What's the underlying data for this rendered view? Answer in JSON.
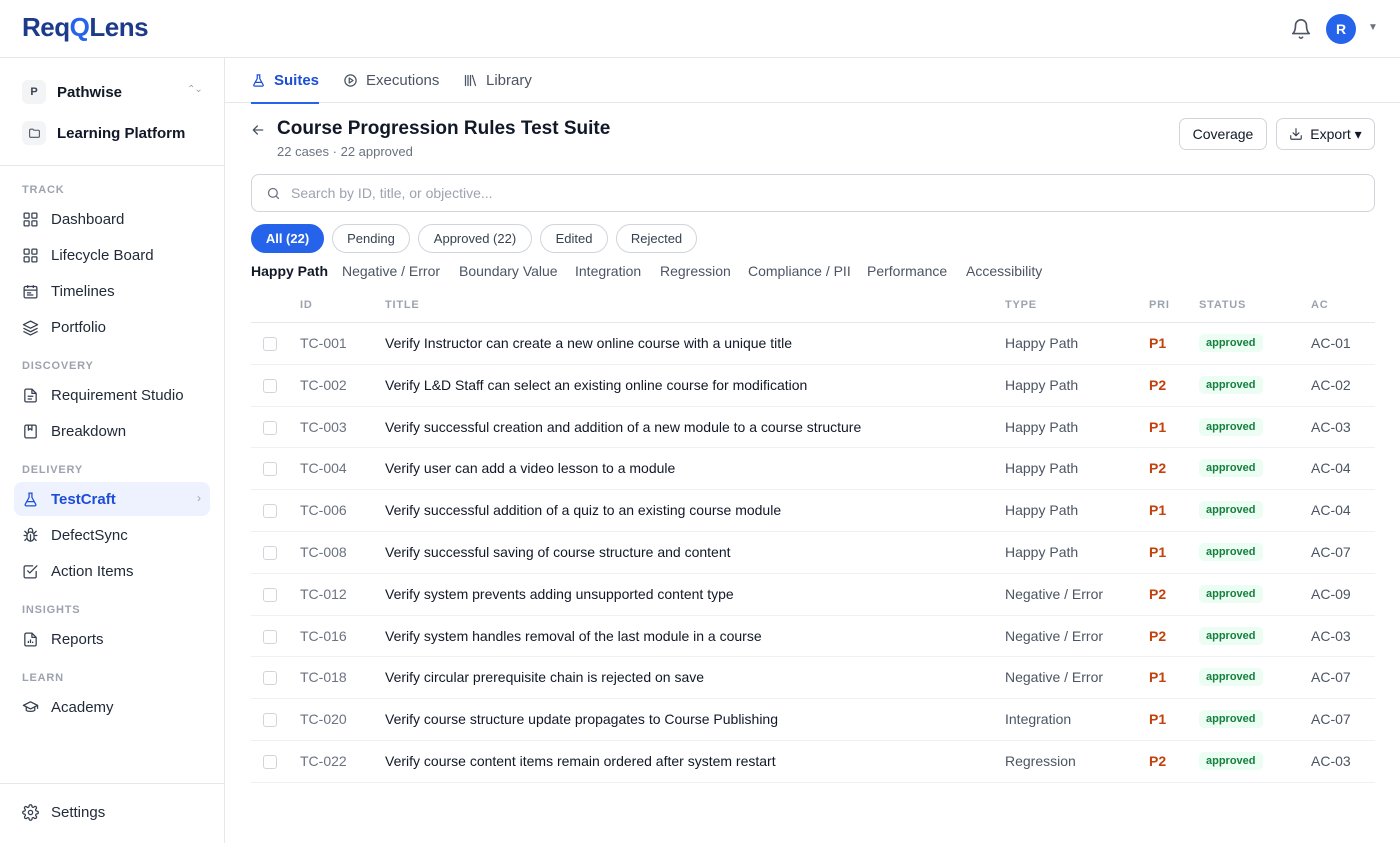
{
  "app": {
    "logo_part1": "Req",
    "logo_q": "Q",
    "logo_part2": "Lens",
    "user_initial": "R"
  },
  "workspace": {
    "org_initial": "P",
    "org_name": "Pathwise",
    "project_name": "Learning Platform"
  },
  "sidebar": {
    "sections": {
      "track": "TRACK",
      "discovery": "DISCOVERY",
      "delivery": "DELIVERY",
      "insights": "INSIGHTS",
      "learn": "LEARN"
    },
    "items": {
      "dashboard": "Dashboard",
      "lifecycle": "Lifecycle Board",
      "timelines": "Timelines",
      "portfolio": "Portfolio",
      "requirement_studio": "Requirement Studio",
      "breakdown": "Breakdown",
      "testcraft": "TestCraft",
      "defectsync": "DefectSync",
      "action_items": "Action Items",
      "reports": "Reports",
      "academy": "Academy",
      "settings": "Settings"
    },
    "active_item": "testcraft"
  },
  "tabs": {
    "suites": "Suites",
    "executions": "Executions",
    "library": "Library",
    "active": "suites"
  },
  "header": {
    "title": "Course Progression Rules Test Suite",
    "subtitle": "22 cases · 22 approved",
    "coverage_label": "Coverage",
    "export_label": "Export ▾"
  },
  "search": {
    "placeholder": "Search by ID, title, or objective...",
    "value": ""
  },
  "status_filters": [
    "All (22)",
    "Pending",
    "Approved (22)",
    "Edited",
    "Rejected"
  ],
  "status_filter_active": "All (22)",
  "categories": [
    "Happy Path",
    "Negative / Error",
    "Boundary Value",
    "Integration",
    "Regression",
    "Compliance / PII",
    "Performance",
    "Accessibility"
  ],
  "category_active": "Happy Path",
  "table": {
    "columns": {
      "id": "ID",
      "title": "TITLE",
      "type": "TYPE",
      "priority": "PRI",
      "status": "STATUS",
      "ac": "AC"
    },
    "rows": [
      {
        "id": "TC-001",
        "title": "Verify Instructor can create a new online course with a unique title",
        "type": "Happy Path",
        "priority": "P1",
        "status": "approved",
        "ac": "AC-01"
      },
      {
        "id": "TC-002",
        "title": "Verify L&D Staff can select an existing online course for modification",
        "type": "Happy Path",
        "priority": "P2",
        "status": "approved",
        "ac": "AC-02"
      },
      {
        "id": "TC-003",
        "title": "Verify successful creation and addition of a new module to a course structure",
        "type": "Happy Path",
        "priority": "P1",
        "status": "approved",
        "ac": "AC-03"
      },
      {
        "id": "TC-004",
        "title": "Verify user can add a video lesson to a module",
        "type": "Happy Path",
        "priority": "P2",
        "status": "approved",
        "ac": "AC-04"
      },
      {
        "id": "TC-006",
        "title": "Verify successful addition of a quiz to an existing course module",
        "type": "Happy Path",
        "priority": "P1",
        "status": "approved",
        "ac": "AC-04"
      },
      {
        "id": "TC-008",
        "title": "Verify successful saving of course structure and content",
        "type": "Happy Path",
        "priority": "P1",
        "status": "approved",
        "ac": "AC-07"
      },
      {
        "id": "TC-012",
        "title": "Verify system prevents adding unsupported content type",
        "type": "Negative / Error",
        "priority": "P2",
        "status": "approved",
        "ac": "AC-09"
      },
      {
        "id": "TC-016",
        "title": "Verify system handles removal of the last module in a course",
        "type": "Negative / Error",
        "priority": "P2",
        "status": "approved",
        "ac": "AC-03"
      },
      {
        "id": "TC-018",
        "title": "Verify circular prerequisite chain is rejected on save",
        "type": "Negative / Error",
        "priority": "P1",
        "status": "approved",
        "ac": "AC-07"
      },
      {
        "id": "TC-020",
        "title": "Verify course structure update propagates to Course Publishing",
        "type": "Integration",
        "priority": "P1",
        "status": "approved",
        "ac": "AC-07"
      },
      {
        "id": "TC-022",
        "title": "Verify course content items remain ordered after system restart",
        "type": "Regression",
        "priority": "P2",
        "status": "approved",
        "ac": "AC-03"
      }
    ]
  },
  "colors": {
    "accent": "#2563eb",
    "brand": "#1e3a8a",
    "priority": "#c2410c",
    "approved": "#15803d"
  }
}
